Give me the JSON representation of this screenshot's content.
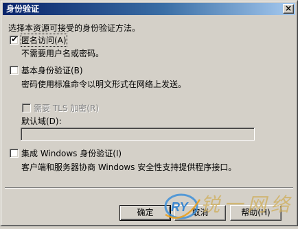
{
  "dialog": {
    "title": "身份验证",
    "close_glyph": "×"
  },
  "intro": "选择本资源可接受的身份验证方法。",
  "anonymous": {
    "checked": true,
    "label": "匿名访问(A)",
    "description": "不需要用户名或密码。"
  },
  "basic": {
    "checked": false,
    "label": "基本身份验证(B)",
    "description": "密码使用标准命令以明文形式在网络上发送。"
  },
  "tls": {
    "checked": false,
    "enabled": false,
    "label": "需要 TLS 加密(R)"
  },
  "default_domain": {
    "label": "默认域(D):",
    "value": ""
  },
  "windows": {
    "checked": false,
    "label": "集成 Windows 身份验证(I)",
    "description": "客户端和服务器协商 Windows 安全性支持提供程序接口。"
  },
  "buttons": {
    "ok": "确定",
    "cancel": "取消",
    "help": "帮助(H)"
  },
  "watermark": {
    "logo_text": "RY",
    "text": "锐一网络"
  },
  "colors": {
    "face": "#d4d0c8",
    "title_start": "#0a246a",
    "title_end": "#a6caf0"
  }
}
